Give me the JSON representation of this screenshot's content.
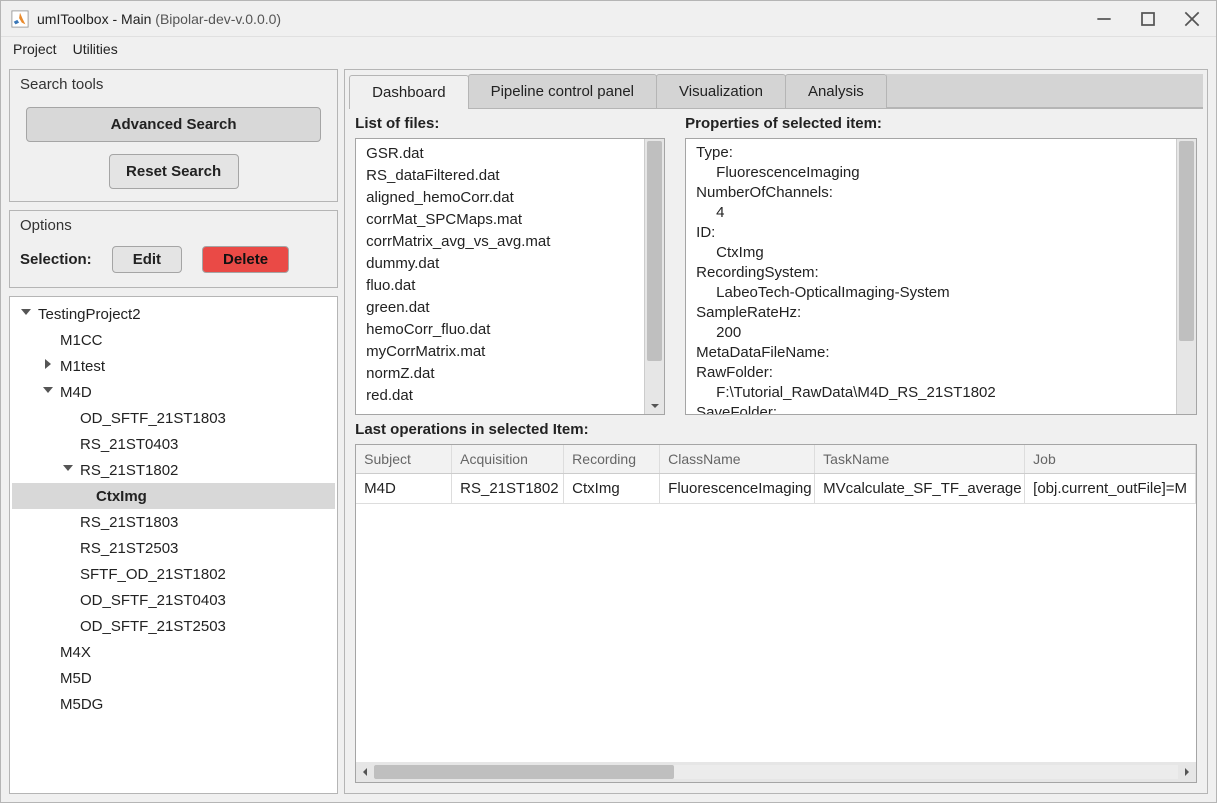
{
  "window": {
    "title_primary": "umIToolbox - Main",
    "title_secondary": "  (Bipolar-dev-v.0.0.0)"
  },
  "menubar": [
    "Project",
    "Utilities"
  ],
  "search_panel": {
    "title": "Search tools",
    "advanced_button": "Advanced Search",
    "reset_button": "Reset Search"
  },
  "options_panel": {
    "title": "Options",
    "selection_label": "Selection:",
    "edit_button": "Edit",
    "delete_button": "Delete"
  },
  "tree": [
    {
      "label": "TestingProject2",
      "level": 0,
      "expanded": true,
      "hasChildren": true
    },
    {
      "label": "M1CC",
      "level": 1,
      "hasChildren": false
    },
    {
      "label": "M1test",
      "level": 1,
      "expanded": false,
      "hasChildren": true
    },
    {
      "label": "M4D",
      "level": 1,
      "expanded": true,
      "hasChildren": true
    },
    {
      "label": "OD_SFTF_21ST1803",
      "level": 2,
      "hasChildren": false
    },
    {
      "label": "RS_21ST0403",
      "level": 2,
      "hasChildren": false
    },
    {
      "label": "RS_21ST1802",
      "level": 2,
      "expanded": true,
      "hasChildren": true
    },
    {
      "label": "CtxImg",
      "level": 3,
      "hasChildren": false,
      "selected": true
    },
    {
      "label": "RS_21ST1803",
      "level": 2,
      "hasChildren": false
    },
    {
      "label": "RS_21ST2503",
      "level": 2,
      "hasChildren": false
    },
    {
      "label": "SFTF_OD_21ST1802",
      "level": 2,
      "hasChildren": false
    },
    {
      "label": "OD_SFTF_21ST0403",
      "level": 2,
      "hasChildren": false
    },
    {
      "label": "OD_SFTF_21ST2503",
      "level": 2,
      "hasChildren": false
    },
    {
      "label": "M4X",
      "level": 1,
      "hasChildren": false
    },
    {
      "label": "M5D",
      "level": 1,
      "hasChildren": false
    },
    {
      "label": "M5DG",
      "level": 1,
      "hasChildren": false
    }
  ],
  "tabs": [
    {
      "label": "Dashboard",
      "active": true
    },
    {
      "label": "Pipeline control panel",
      "active": false
    },
    {
      "label": "Visualization",
      "active": false
    },
    {
      "label": "Analysis",
      "active": false
    }
  ],
  "dashboard": {
    "files_label": "List of files:",
    "files": [
      "GSR.dat",
      "RS_dataFiltered.dat",
      "aligned_hemoCorr.dat",
      "corrMat_SPCMaps.mat",
      "corrMatrix_avg_vs_avg.mat",
      "dummy.dat",
      "fluo.dat",
      "green.dat",
      "hemoCorr_fluo.dat",
      "myCorrMatrix.mat",
      "normZ.dat",
      "red.dat"
    ],
    "properties_label": "Properties of selected item:",
    "properties": [
      {
        "key": "Type:",
        "value": "FluorescenceImaging"
      },
      {
        "key": "NumberOfChannels:",
        "value": "4"
      },
      {
        "key": "ID:",
        "value": "CtxImg"
      },
      {
        "key": "RecordingSystem:",
        "value": "LabeoTech-OpticalImaging-System"
      },
      {
        "key": "SampleRateHz:",
        "value": "200"
      },
      {
        "key": "MetaDataFileName:",
        "value": ""
      },
      {
        "key": "RawFolder:",
        "value": "F:\\Tutorial_RawData\\M4D_RS_21ST1802"
      },
      {
        "key": "SaveFolder:",
        "value": ""
      }
    ],
    "operations_label": "Last operations in selected Item:",
    "operations_columns": [
      "Subject",
      "Acquisition",
      "Recording",
      "ClassName",
      "TaskName",
      "Job"
    ],
    "operations_rows": [
      {
        "subject": "M4D",
        "acquisition": "RS_21ST1802",
        "recording": "CtxImg",
        "className": "FluorescenceImaging",
        "taskName": "MVcalculate_SF_TF_average",
        "job": "[obj.current_outFile]=M"
      }
    ]
  }
}
